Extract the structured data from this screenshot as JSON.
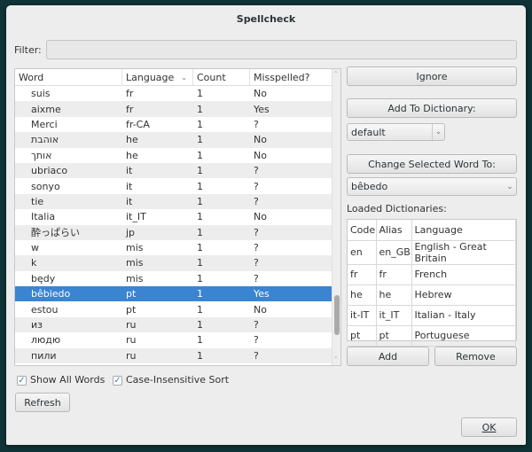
{
  "title": "Spellcheck",
  "filter": {
    "label": "Filter:",
    "value": ""
  },
  "words": {
    "columns": [
      "Word",
      "Language",
      "Count",
      "Misspelled?"
    ],
    "rows": [
      [
        "suis",
        "fr",
        "1",
        "No"
      ],
      [
        "aixme",
        "fr",
        "1",
        "Yes"
      ],
      [
        "Merci",
        "fr-CA",
        "1",
        "?"
      ],
      [
        "אוהבת",
        "he",
        "1",
        "No"
      ],
      [
        "אותך",
        "he",
        "1",
        "No"
      ],
      [
        "ubriaco",
        "it",
        "1",
        "?"
      ],
      [
        "sonyo",
        "it",
        "1",
        "?"
      ],
      [
        "tie",
        "it",
        "1",
        "?"
      ],
      [
        "Italia",
        "it_IT",
        "1",
        "No"
      ],
      [
        "酔っぱらい",
        "jp",
        "1",
        "?"
      ],
      [
        "w",
        "mis",
        "1",
        "?"
      ],
      [
        "k",
        "mis",
        "1",
        "?"
      ],
      [
        "będy",
        "mis",
        "1",
        "?"
      ],
      [
        "bêbiedo",
        "pt",
        "1",
        "Yes"
      ],
      [
        "estou",
        "pt",
        "1",
        "No"
      ],
      [
        "из",
        "ru",
        "1",
        "?"
      ],
      [
        "людю",
        "ru",
        "1",
        "?"
      ],
      [
        "пили",
        "ru",
        "1",
        "?"
      ]
    ],
    "selected_index": 13
  },
  "actions": {
    "ignore": "Ignore",
    "add_to_dictionary": "Add To Dictionary:",
    "dictionary_select": "default",
    "change_word": "Change Selected Word To:",
    "replacement": "bêbedo"
  },
  "dictionaries": {
    "label": "Loaded Dictionaries:",
    "columns": [
      "Code",
      "Alias",
      "Language"
    ],
    "rows": [
      [
        "en",
        "en_GB",
        "English - Great Britain"
      ],
      [
        "fr",
        "fr",
        "French"
      ],
      [
        "he",
        "he",
        "Hebrew"
      ],
      [
        "it-IT",
        "it_IT",
        "Italian - Italy"
      ],
      [
        "pt",
        "pt",
        "Portuguese"
      ]
    ],
    "add": "Add",
    "remove": "Remove"
  },
  "options": {
    "show_all_words": "Show All Words",
    "case_insensitive": "Case-Insensitive Sort"
  },
  "refresh": "Refresh",
  "ok": "OK"
}
